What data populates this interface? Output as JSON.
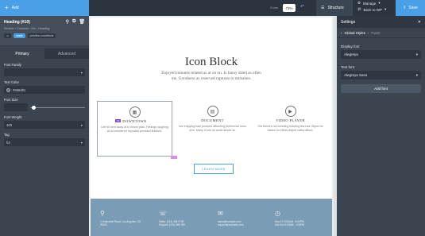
{
  "topbar": {
    "add_label": "Add",
    "zoom_label": "Zoom",
    "zoom_value": "73%",
    "structure_label": "Structure",
    "manage_label": "Manage",
    "back_label": "Back to WP",
    "save_label": "Save"
  },
  "left_panel": {
    "title": "Heading (#10)",
    "breadcrumb": "Section › Columns › Div › Heading",
    "class_tag": "class",
    "class_value": "preview-conditions",
    "tabs": [
      {
        "label": "Primary"
      },
      {
        "label": "Advanced"
      }
    ],
    "fields": {
      "font_family_label": "Font Family",
      "text_color_label": "Text Color",
      "text_color_value": "#666d81",
      "font_size_label": "Font Size",
      "font_weight_label": "Font Weight",
      "font_weight_value": "400",
      "tag_label": "Tag",
      "tag_value": "h3"
    }
  },
  "canvas": {
    "title": "Icon Block",
    "subtitle": "Enjoyed minutes related as at on on. Is fanny dried as often me. Goodness as reserved raptures to mistaken.",
    "features": [
      {
        "title": "DOWNTOWN",
        "desc": "Left till here away at to whom past. Feelings laughing at no wondered repeated provided finished."
      },
      {
        "title": "DOCUMENT",
        "desc": "Are enjoying ham proceed affronting preference sons who. Marry of am do avoid ample as."
      },
      {
        "title": "VIDEO PLAYER",
        "desc": "Old friend's not breeding building few has Object he barton no effect played valley afford."
      }
    ],
    "heading_tag": "h3",
    "learn_more": "LEARN MORE",
    "footer": [
      {
        "line1": "1 Hostname Road, Los Angeles, CA",
        "line2": "90000"
      },
      {
        "line1": "Sales: (123) 456 0789",
        "line2": "Support: (123) 456 789"
      },
      {
        "line1": "sales@example.com",
        "line2": "support@example.com"
      },
      {
        "line1": "Mon-Fri 9:00AM - 5:00PM",
        "line2": "Sat-Sun 9:00AM - 1:00PM"
      }
    ]
  },
  "right_panel": {
    "title": "Settings",
    "crumb_active": "Global Styles",
    "crumb_sep": "/",
    "crumb_muted": "Fonts",
    "display_font_label": "Display font",
    "display_font_value": "Alegreya",
    "text_font_label": "Text font",
    "text_font_value": "Alegreya Sans",
    "add_font": "Add font"
  }
}
